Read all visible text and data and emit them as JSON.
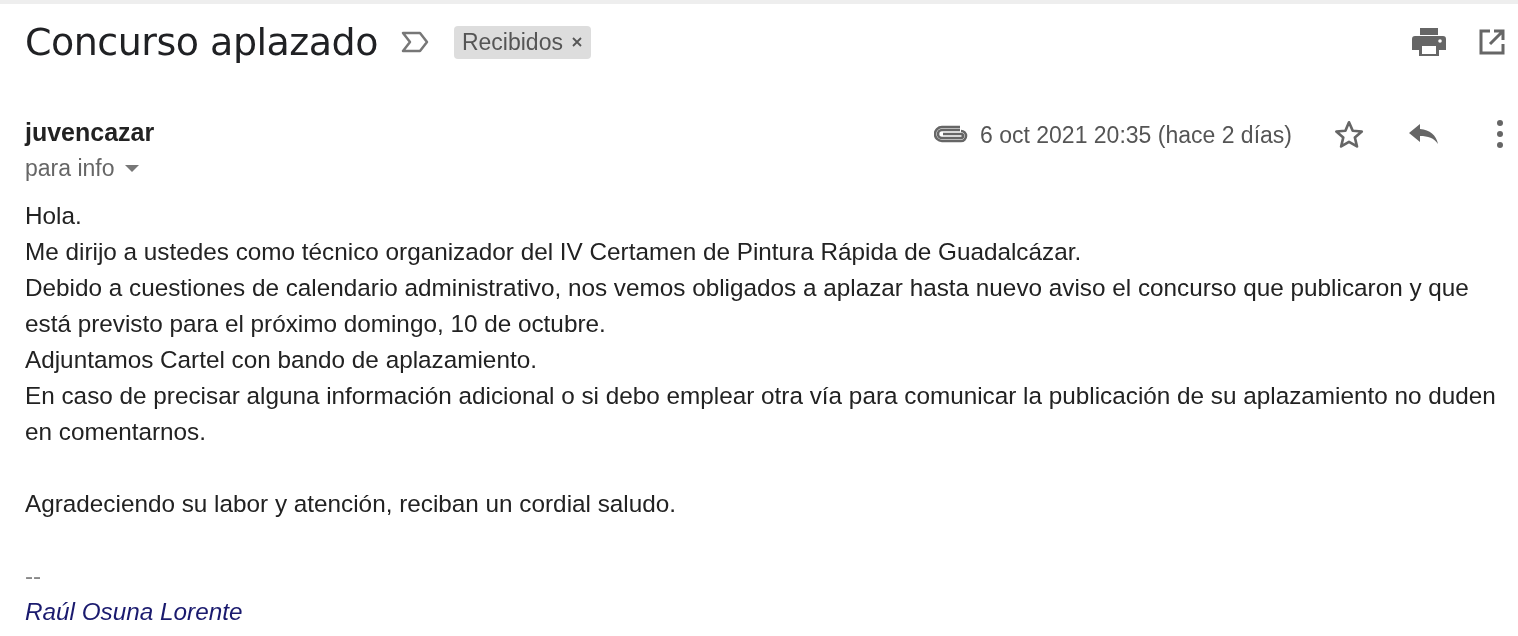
{
  "subject": "Concurso aplazado",
  "important": false,
  "labels": [
    {
      "text": "Recibidos"
    }
  ],
  "sender": {
    "name": "juvencazar",
    "recipients": "para info",
    "has_attachment": true,
    "date": "6 oct 2021 20:35 (hace 2 días)",
    "starred": false
  },
  "body": [
    {
      "lines": [
        "Hola.",
        "Me dirijo a ustedes como técnico organizador del IV Certamen de Pintura Rápida de Guadalcázar.",
        "Debido a cuestiones de calendario administrativo, nos vemos obligados a aplazar hasta nuevo aviso el concurso que publicaron y que está previsto para el próximo domingo, 10 de octubre.",
        "Adjuntamos Cartel con bando de aplazamiento.",
        "En caso de precisar alguna información adicional o si debo emplear otra vía para comunicar la publicación de su aplazamiento no duden en comentarnos."
      ]
    },
    {
      "lines": [
        "Agradeciendo su labor y atención, reciban un cordial saludo."
      ]
    }
  ],
  "signature": {
    "separator": "--",
    "name": "Raúl Osuna Lorente"
  }
}
